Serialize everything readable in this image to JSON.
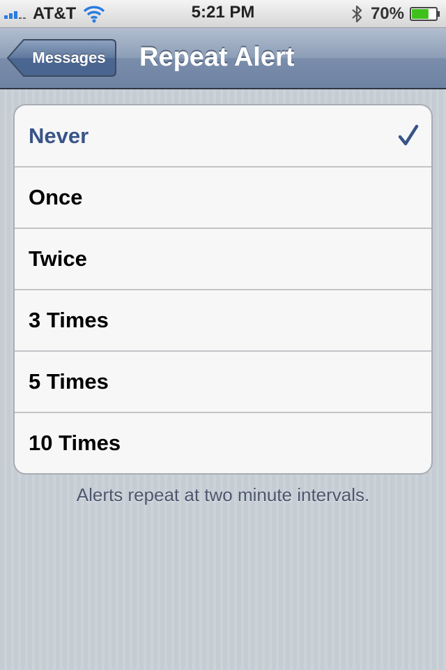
{
  "status_bar": {
    "carrier": "AT&T",
    "time": "5:21 PM",
    "battery_percent": "70%",
    "battery_level": 0.7
  },
  "nav": {
    "back_label": "Messages",
    "title": "Repeat Alert"
  },
  "options": [
    {
      "label": "Never",
      "selected": true
    },
    {
      "label": "Once",
      "selected": false
    },
    {
      "label": "Twice",
      "selected": false
    },
    {
      "label": "3 Times",
      "selected": false
    },
    {
      "label": "5 Times",
      "selected": false
    },
    {
      "label": "10 Times",
      "selected": false
    }
  ],
  "footer_text": "Alerts repeat at two minute intervals.",
  "colors": {
    "selected_text": "#385487",
    "signal": "#2a7be0",
    "battery": "#3fc01b"
  },
  "icons": [
    "signal-icon",
    "wifi-icon",
    "bluetooth-icon",
    "battery-icon",
    "back-chevron",
    "checkmark-icon"
  ]
}
